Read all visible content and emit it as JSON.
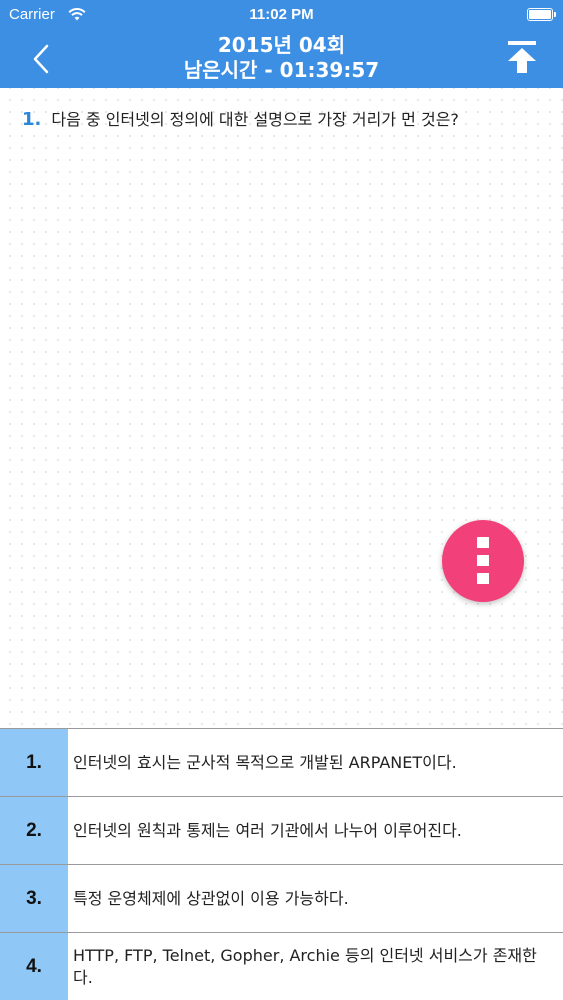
{
  "status_bar": {
    "carrier": "Carrier",
    "time": "11:02 PM"
  },
  "nav": {
    "title": "2015년 04회",
    "subtitle": "남은시간 - 01:39:57"
  },
  "question": {
    "number": "1.",
    "text": "다음 중 인터넷의 정의에 대한 설명으로 가장 거리가 먼 것은?"
  },
  "answers": [
    {
      "number": "1.",
      "text": "인터넷의 효시는 군사적 목적으로 개발된 ARPANET이다."
    },
    {
      "number": "2.",
      "text": "인터넷의 원칙과 통제는 여러 기관에서 나누어 이루어진다."
    },
    {
      "number": "3.",
      "text": "특정 운영체제에 상관없이 이용 가능하다."
    },
    {
      "number": "4.",
      "text": "HTTP, FTP, Telnet, Gopher, Archie 등의 인터넷 서비스가 존재한다."
    }
  ],
  "colors": {
    "nav_background": "#3d8fe4",
    "question_number": "#2b85d9",
    "answer_number_background": "#8fc8f7",
    "fab_background": "#f2407a"
  },
  "icons": {
    "back": "chevron-left-icon",
    "scroll_top": "arrow-up-to-top-icon",
    "menu": "more-vertical-icon",
    "wifi": "wifi-icon",
    "battery": "battery-icon"
  }
}
